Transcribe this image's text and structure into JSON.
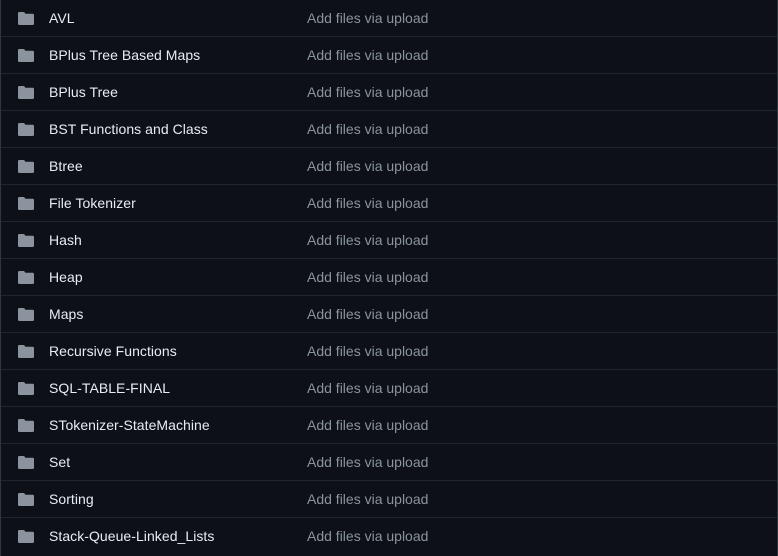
{
  "colors": {
    "background": "#0d1117",
    "row_border": "#21262d",
    "folder_icon": "#8b949e",
    "name_text": "#e6edf3",
    "commit_text": "#8b949e"
  },
  "rows": [
    {
      "icon": "folder-icon",
      "name": "AVL",
      "commit": "Add files via upload"
    },
    {
      "icon": "folder-icon",
      "name": "BPlus Tree Based Maps",
      "commit": "Add files via upload"
    },
    {
      "icon": "folder-icon",
      "name": "BPlus Tree",
      "commit": "Add files via upload"
    },
    {
      "icon": "folder-icon",
      "name": "BST Functions and Class",
      "commit": "Add files via upload"
    },
    {
      "icon": "folder-icon",
      "name": "Btree",
      "commit": "Add files via upload"
    },
    {
      "icon": "folder-icon",
      "name": "File Tokenizer",
      "commit": "Add files via upload"
    },
    {
      "icon": "folder-icon",
      "name": "Hash",
      "commit": "Add files via upload"
    },
    {
      "icon": "folder-icon",
      "name": "Heap",
      "commit": "Add files via upload"
    },
    {
      "icon": "folder-icon",
      "name": "Maps",
      "commit": "Add files via upload"
    },
    {
      "icon": "folder-icon",
      "name": "Recursive Functions",
      "commit": "Add files via upload"
    },
    {
      "icon": "folder-icon",
      "name": "SQL-TABLE-FINAL",
      "commit": "Add files via upload"
    },
    {
      "icon": "folder-icon",
      "name": "STokenizer-StateMachine",
      "commit": "Add files via upload"
    },
    {
      "icon": "folder-icon",
      "name": "Set",
      "commit": "Add files via upload"
    },
    {
      "icon": "folder-icon",
      "name": "Sorting",
      "commit": "Add files via upload"
    },
    {
      "icon": "folder-icon",
      "name": "Stack-Queue-Linked_Lists",
      "commit": "Add files via upload"
    }
  ]
}
